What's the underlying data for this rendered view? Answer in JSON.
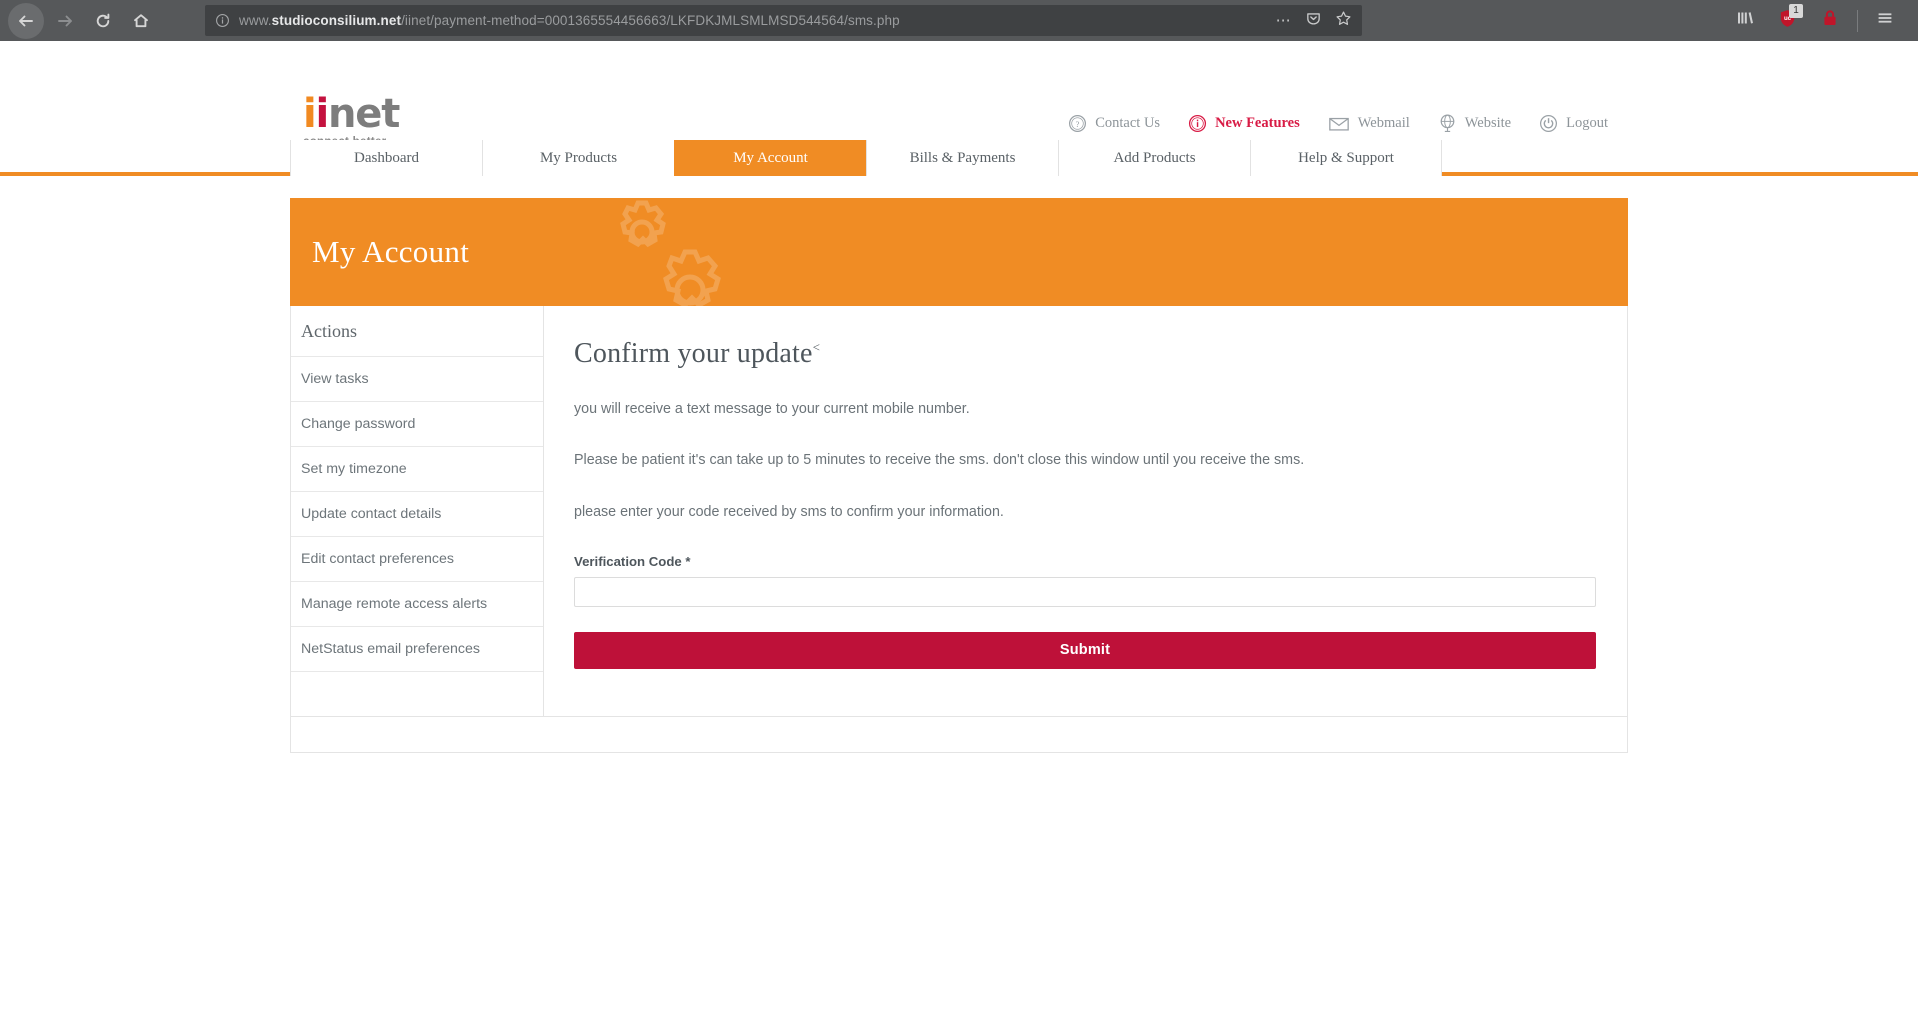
{
  "browser": {
    "back_icon": "back-arrow-icon",
    "forward_icon": "forward-arrow-icon",
    "reload_icon": "reload-icon",
    "home_icon": "home-icon",
    "url": "www.studioconsilium.net/iinet/payment-method=0001365554456663/LKFDKJMLSMLMSD544564/sms.php",
    "url_domain_bold": "studioconsilium.net",
    "url_prefix": "www.",
    "url_suffix": "/iinet/payment-method=0001365554456663/LKFDKJMLSMLMSD544564/sms.php",
    "site_info_icon": "info-circle-icon",
    "page_actions_icon": "ellipsis-icon",
    "pocket_icon": "pocket-save-icon",
    "bookmark_icon": "star-bookmark-icon",
    "library_icon": "library-icon",
    "shield_icon": "shield-badge-icon",
    "shield_badge_count": "1",
    "padlock_icon": "padlock-icon",
    "menu_icon": "hamburger-menu-icon"
  },
  "site": {
    "logo": {
      "part1": "i",
      "part2": "i",
      "part3": "net",
      "tagline": "connect  better"
    },
    "header_links": [
      {
        "label": "Contact Us",
        "icon": "question-circle-icon",
        "accent": false
      },
      {
        "label": "New Features",
        "icon": "info-circle-icon",
        "accent": true
      },
      {
        "label": "Webmail",
        "icon": "envelope-icon",
        "accent": false
      },
      {
        "label": "Website",
        "icon": "globe-icon",
        "accent": false
      },
      {
        "label": "Logout",
        "icon": "power-icon",
        "accent": false
      }
    ],
    "nav_tabs": [
      {
        "label": "Dashboard",
        "active": false
      },
      {
        "label": "My Products",
        "active": false
      },
      {
        "label": "My Account",
        "active": true
      },
      {
        "label": "Bills & Payments",
        "active": false
      },
      {
        "label": "Add Products",
        "active": false
      },
      {
        "label": "Help & Support",
        "active": false
      }
    ],
    "banner_title": "My Account"
  },
  "sidebar": {
    "heading": "Actions",
    "items": [
      {
        "label": "View tasks"
      },
      {
        "label": "Change password"
      },
      {
        "label": "Set my timezone"
      },
      {
        "label": "Update contact details"
      },
      {
        "label": "Edit contact preferences"
      },
      {
        "label": "Manage remote access alerts"
      },
      {
        "label": "NetStatus email preferences"
      }
    ]
  },
  "main": {
    "heading": "Confirm your update",
    "heading_sup": "<",
    "paragraphs": [
      "you will receive a text message to your current mobile number.",
      "Please be patient it's can take up to 5 minutes to receive the sms. don't close this window until you receive the sms.",
      "please enter your code received by sms to confirm your information."
    ],
    "form": {
      "verification_label": "Verification Code *",
      "verification_value": "",
      "verification_placeholder": "",
      "submit_label": "Submit"
    }
  },
  "colors": {
    "brand_orange": "#F08C24",
    "brand_crimson": "#BE1139",
    "logo_orange": "#F18A21",
    "logo_crimson": "#C4123F",
    "accent_link": "#D81B45",
    "chrome_bg": "#56585a",
    "urlbar_bg": "#3f4143"
  }
}
